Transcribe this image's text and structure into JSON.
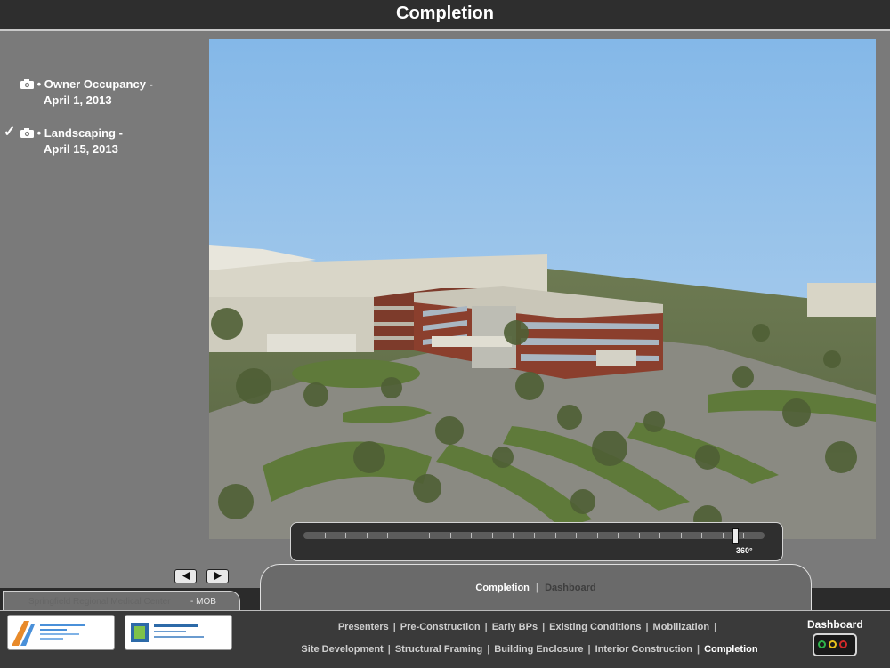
{
  "header": {
    "title": "Completion"
  },
  "milestones": [
    {
      "icon": "camera-icon",
      "label": "• Owner Occupancy -",
      "date": "April 1, 2013",
      "checked": false
    },
    {
      "icon": "camera-icon",
      "label": "• Landscaping  -",
      "date": "April 15, 2013",
      "checked": true
    }
  ],
  "check_glyph": "✓",
  "slider": {
    "label": "360°",
    "value_fraction": 0.93
  },
  "subnav": {
    "current": "Completion",
    "separator": "|",
    "link": "Dashboard"
  },
  "project": {
    "name": "Springfield Regional Medical Center",
    "suffix": "- MOB"
  },
  "footer": {
    "row1": [
      "Presenters",
      "Pre-Construction",
      "Early BPs",
      "Existing Conditions",
      "Mobilization"
    ],
    "row1_trailing_sep": "|",
    "row2": [
      "Site Development",
      "Structural Framing",
      "Building Enclosure",
      "Interior Construction",
      "Completion"
    ],
    "active": "Completion",
    "separator": "|",
    "dashboard_label": "Dashboard"
  },
  "colors": {
    "lamp_green": "#2fb34a",
    "lamp_yellow": "#e8c21c",
    "lamp_red": "#d32a2a"
  }
}
